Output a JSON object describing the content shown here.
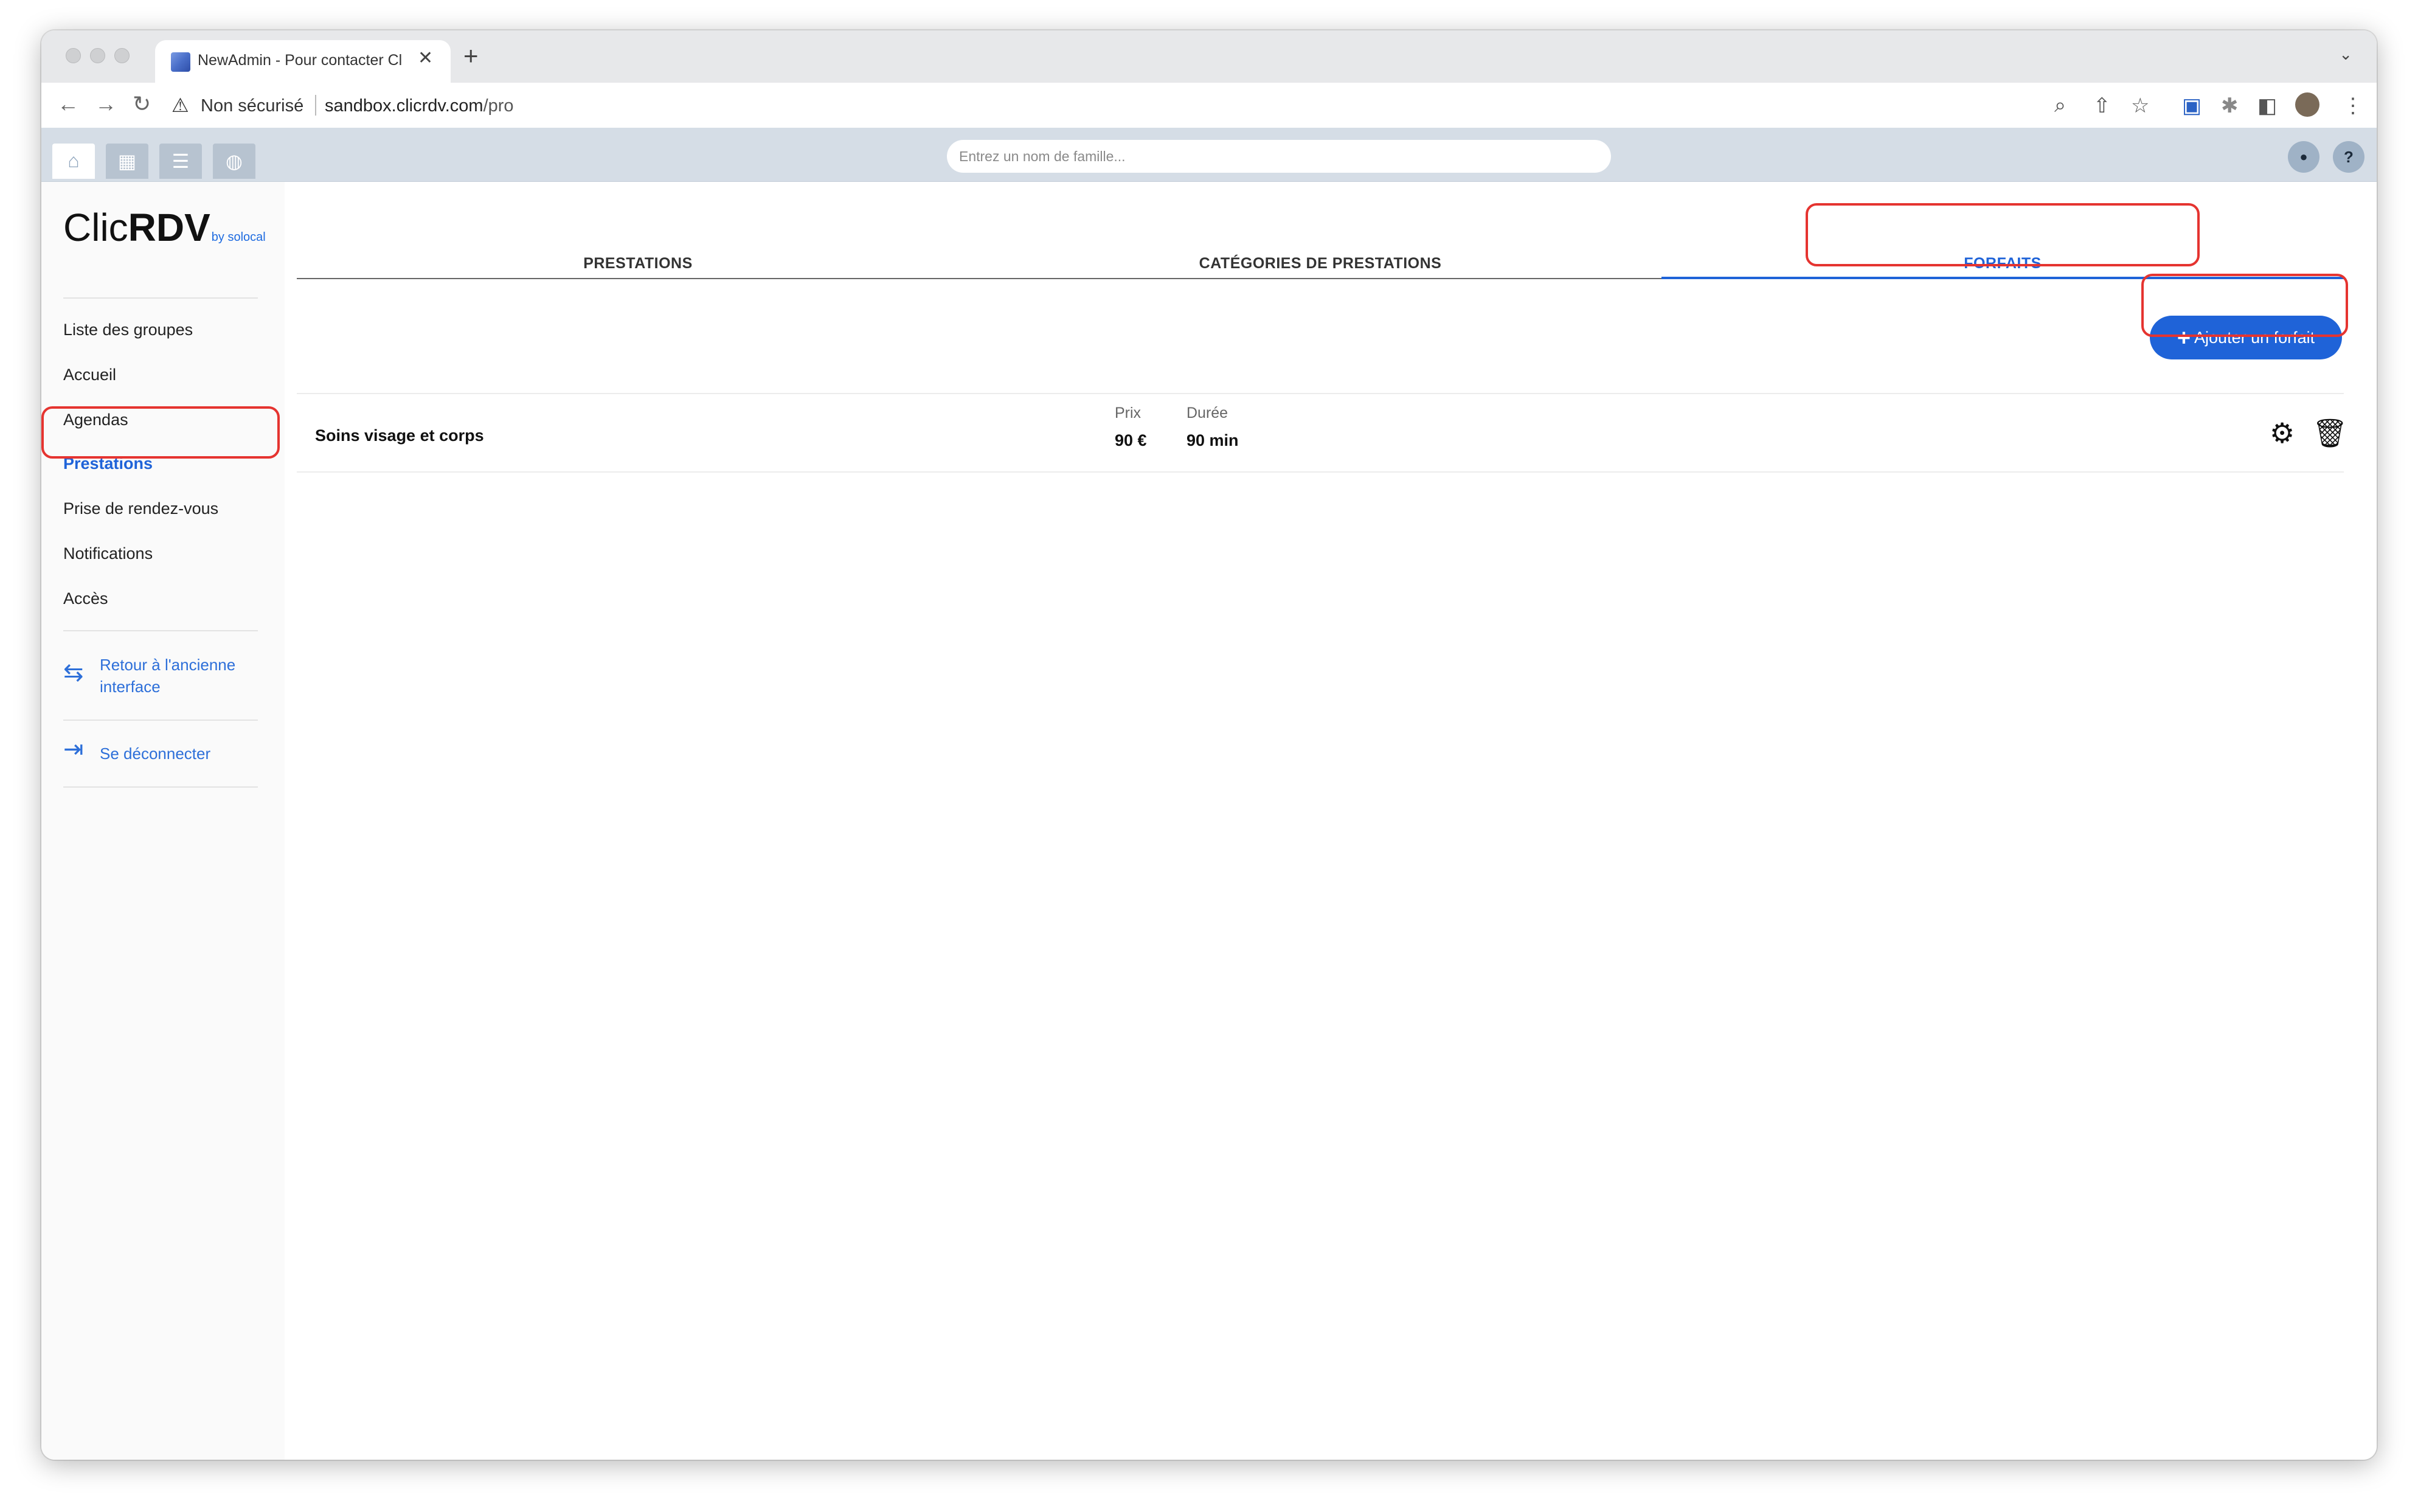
{
  "browser": {
    "tab_title": "NewAdmin - Pour contacter Cl",
    "tab_close": "✕",
    "new_tab": "+",
    "tab_menu": "⌄",
    "not_secure": "Non sécurisé",
    "url_host": "sandbox.clicrdv.com",
    "url_path": "/pro"
  },
  "header": {
    "search_placeholder": "Entrez un nom de famille...",
    "user_icon": "user-icon",
    "help_label": "?"
  },
  "logo": {
    "part1": "Clic",
    "part2": "RDV",
    "by": "by solocal"
  },
  "sidebar": {
    "items": [
      {
        "label": "Liste des groupes"
      },
      {
        "label": "Accueil"
      },
      {
        "label": "Agendas"
      },
      {
        "label": "Prestations",
        "active": true
      },
      {
        "label": "Prise de rendez-vous"
      },
      {
        "label": "Notifications"
      },
      {
        "label": "Accès"
      }
    ],
    "back_link": "Retour à l'ancienne interface",
    "logout_link": "Se déconnecter"
  },
  "main": {
    "tabs": [
      {
        "label": "PRESTATIONS"
      },
      {
        "label": "CATÉGORIES DE PRESTATIONS"
      },
      {
        "label": "FORFAITS",
        "active": true
      }
    ],
    "add_button": "Ajouter un forfait",
    "rows": [
      {
        "name": "Soins visage et corps",
        "price_label": "Prix",
        "price": "90 €",
        "duration_label": "Durée",
        "duration": "90 min"
      }
    ]
  },
  "colors": {
    "accent": "#1f63d8",
    "annotation": "#e53430",
    "header_bg": "#d5dde6"
  }
}
